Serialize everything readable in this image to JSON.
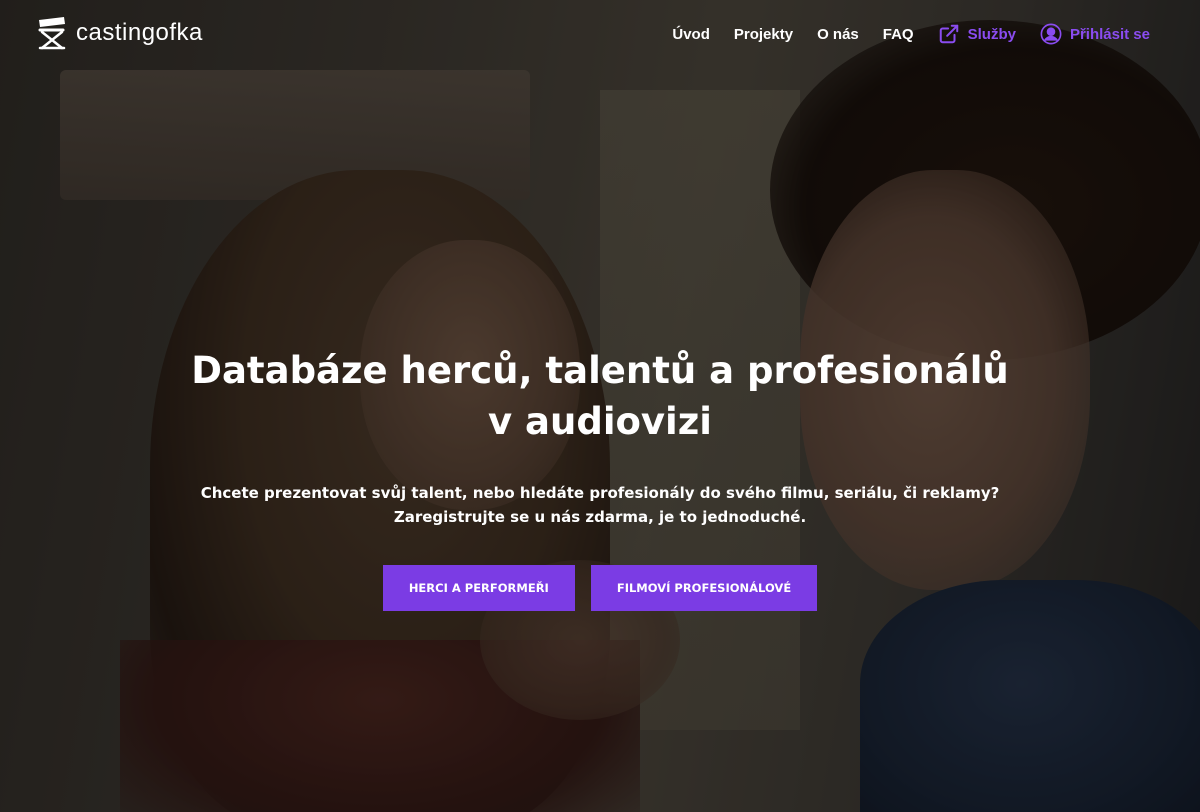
{
  "brand": {
    "name": "castingofka",
    "logo_icon": "director-chair-icon"
  },
  "nav": {
    "items": [
      {
        "label": "Úvod"
      },
      {
        "label": "Projekty"
      },
      {
        "label": "O nás"
      },
      {
        "label": "FAQ"
      },
      {
        "label": "Služby",
        "icon": "external-link-icon"
      },
      {
        "label": "Přihlásit se",
        "icon": "user-icon"
      }
    ],
    "accent_color": "#8a4cf0"
  },
  "hero": {
    "title": "Databáze herců, talentů a profesionálů v audiovizi",
    "subtitle_line1": "Chcete prezentovat svůj talent, nebo hledáte profesionály do svého filmu, seriálu, či reklamy?",
    "subtitle_line2": "Zaregistrujte se u nás zdarma, je to jednoduché.",
    "buttons": [
      {
        "label": "HERCI A PERFORMEŘI"
      },
      {
        "label": "FILMOVÍ PROFESIONÁLOVÉ"
      }
    ],
    "button_color": "#7b3ce4"
  }
}
